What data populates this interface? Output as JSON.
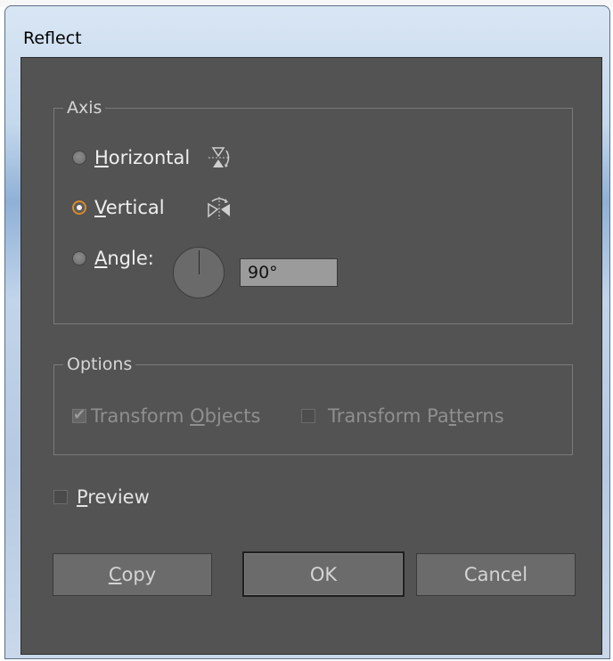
{
  "window": {
    "title": "Reflect"
  },
  "axis": {
    "legend": "Axis",
    "horizontal": {
      "mnemonic": "H",
      "rest": "orizontal",
      "icon": "reflect-horizontal-icon",
      "selected": false
    },
    "vertical": {
      "mnemonic": "V",
      "rest": "ertical",
      "icon": "reflect-vertical-icon",
      "selected": true
    },
    "angle": {
      "mnemonic": "A",
      "rest": "ngle:",
      "value": "90°",
      "selected": false
    }
  },
  "options": {
    "legend": "Options",
    "transform_objects": {
      "before": "Transform ",
      "mnemonic": "O",
      "after": "bjects",
      "checked": true,
      "enabled": false
    },
    "transform_patterns": {
      "before": "Transform Pa",
      "mnemonic": "t",
      "after": "terns",
      "checked": false,
      "enabled": false
    }
  },
  "preview": {
    "mnemonic": "P",
    "rest": "review",
    "checked": false
  },
  "buttons": {
    "copy": {
      "mnemonic": "C",
      "rest": "opy"
    },
    "ok": {
      "label": "OK"
    },
    "cancel": {
      "label": "Cancel"
    }
  },
  "colors": {
    "dialog_bg": "#535353",
    "accent": "#d98a2c"
  }
}
